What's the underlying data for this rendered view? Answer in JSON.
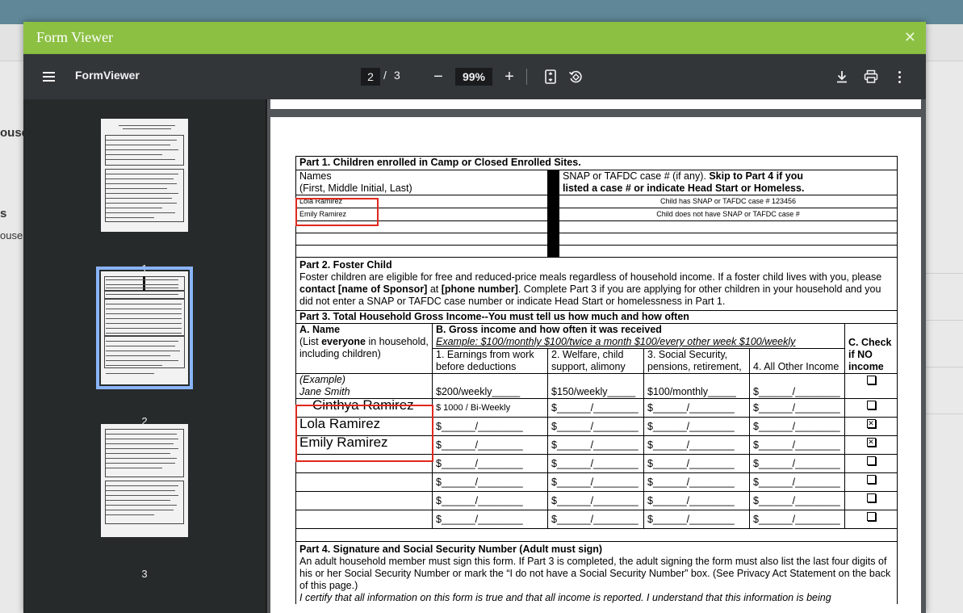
{
  "background": {
    "cut_text_1": "ouse",
    "cut_text_2": "s",
    "cut_text_3": "ouse"
  },
  "window": {
    "title": "Form Viewer",
    "close_glyph": "✕"
  },
  "toolbar": {
    "app_name": "FormViewer",
    "current_page": "2",
    "page_separator": "/",
    "total_pages": "3",
    "zoom_out_glyph": "−",
    "zoom": "99%",
    "zoom_in_glyph": "+"
  },
  "sidebar": {
    "thumbnails": [
      {
        "label": "1",
        "selected": false
      },
      {
        "label": "2",
        "selected": true
      },
      {
        "label": "3",
        "selected": false
      }
    ]
  },
  "form": {
    "part1": {
      "heading": "Part 1. Children enrolled in Camp or Closed Enrolled Sites.",
      "names_label": "Names",
      "names_sublabel": "(First, Middle Initial, Last)",
      "snap_label": "SNAP or TAFDC case # (if any). ",
      "snap_label_bold": "Skip to Part 4 if you",
      "snap_label_bold2": "listed a case # or indicate Head Start or Homeless.",
      "rows": [
        {
          "name": "Lola Ramirez",
          "case": "Child has SNAP or TAFDC case # 123456"
        },
        {
          "name": "Emily Ramirez",
          "case": "Child does not have SNAP or TAFDC case #"
        }
      ]
    },
    "part2": {
      "heading": "Part 2. Foster Child",
      "text_a": "Foster children are eligible for free and reduced-price meals regardless of household income. If a foster child lives with you, please ",
      "text_b": "contact [name of Sponsor]",
      "text_c": " at ",
      "text_d": "[phone number]",
      "text_e": ".  Complete Part 3 if you are applying for other children in your household and you did not enter a SNAP or TAFDC case number or indicate Head Start or homelessness in Part 1."
    },
    "part3": {
      "heading": "Part 3. Total Household Gross Income--You must tell us how much and how often",
      "col_a_title": "A. Name",
      "col_a_sub1": "(List ",
      "col_a_sub_bold": "everyone",
      "col_a_sub2": " in household, including children)",
      "col_b_title": "B. Gross income and how often it was received",
      "col_b_example": "Example:   $100/monthly   $100/twice a month   $100/every other week   $100/weekly",
      "col_c_title": "C. Check if NO income",
      "sub1": "1. Earnings from work before deductions",
      "sub2": "2. Welfare, child support, alimony",
      "sub3": "3. Social Security, pensions, retirement,",
      "sub4": "4. All Other Income",
      "example_label": "(Example)",
      "example_name": "Jane Smith",
      "example_1": "$200/weekly_____",
      "example_2": "$150/weekly_____",
      "example_3": "$100/monthly_____",
      "example_4": "$______/________",
      "blank_income": "$______/________",
      "rows": [
        {
          "name": "Cinthya Ramirez",
          "income1": "$ 1000    / Bi-Weekly",
          "no_income": ""
        },
        {
          "name": "Lola Ramirez",
          "income1": "$______/________",
          "no_income": "✕"
        },
        {
          "name": "Emily Ramirez",
          "income1": "$______/________",
          "no_income": "✕"
        },
        {
          "name": "",
          "income1": "$______/________",
          "no_income": ""
        },
        {
          "name": "",
          "income1": "$______/________",
          "no_income": ""
        },
        {
          "name": "",
          "income1": "$______/________",
          "no_income": ""
        },
        {
          "name": "",
          "income1": "$______/________",
          "no_income": ""
        }
      ]
    },
    "part4": {
      "heading": "Part 4. Signature and Social Security Number (Adult must sign)",
      "text": "An adult household member must sign this form. If Part 3 is completed, the adult signing the form must also list the last four digits of his or her Social Security Number or mark the “I do not have a Social Security Number” box. (See Privacy Act Statement on the back of this page.)",
      "certify": "I certify that all information on this form is true and that all income is reported. I understand that this information is being"
    }
  },
  "colors": {
    "title_bar": "#8cc043",
    "toolbar": "#323639",
    "sidebar": "#262a2b",
    "viewer": "#525659",
    "highlight": "#e0281e",
    "selected_thumb": "#8ab4f8"
  }
}
